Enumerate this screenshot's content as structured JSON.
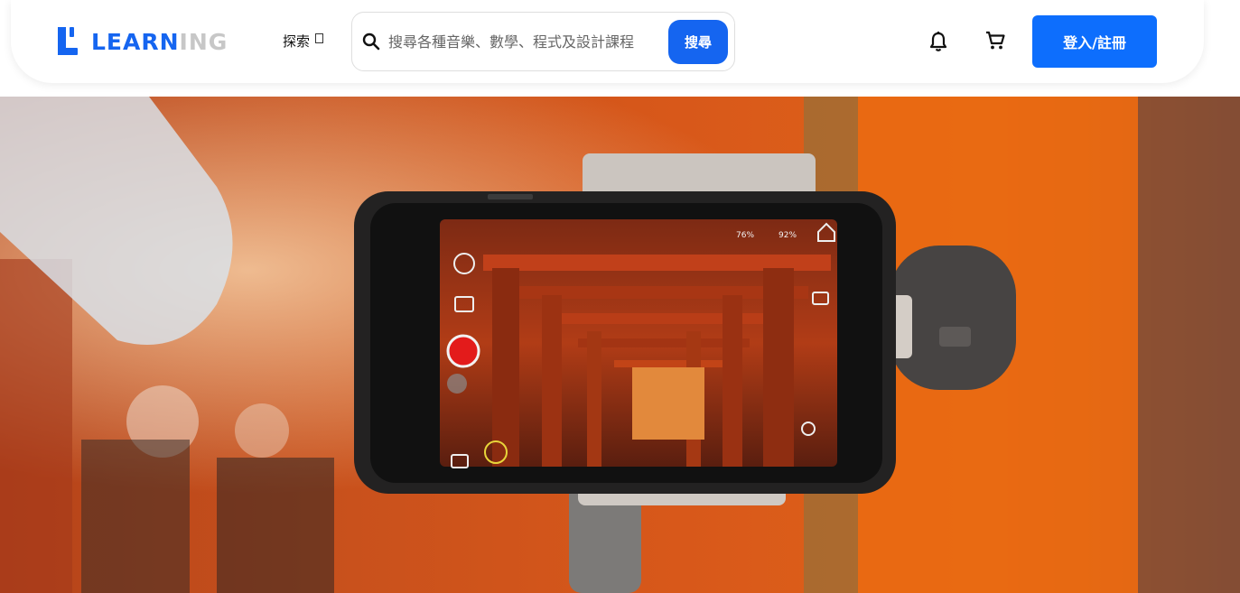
{
  "brand": {
    "logo_primary": "LEARN",
    "logo_secondary": "ING",
    "accent_color": "#1565f0"
  },
  "nav": {
    "explore_label": "探索",
    "explore_icon": "chevron-down-icon"
  },
  "search": {
    "placeholder": "搜尋各種音樂、數學、程式及設計課程",
    "value": "",
    "button_label": "搜尋"
  },
  "header_actions": {
    "notification_icon": "bell-icon",
    "cart_icon": "cart-icon",
    "login_label": "登入/註冊"
  },
  "hero": {
    "image_description_icon": "smartphone-on-gimbal-image",
    "phone_status": {
      "battery_left": "76%",
      "battery_right": "92%"
    }
  }
}
